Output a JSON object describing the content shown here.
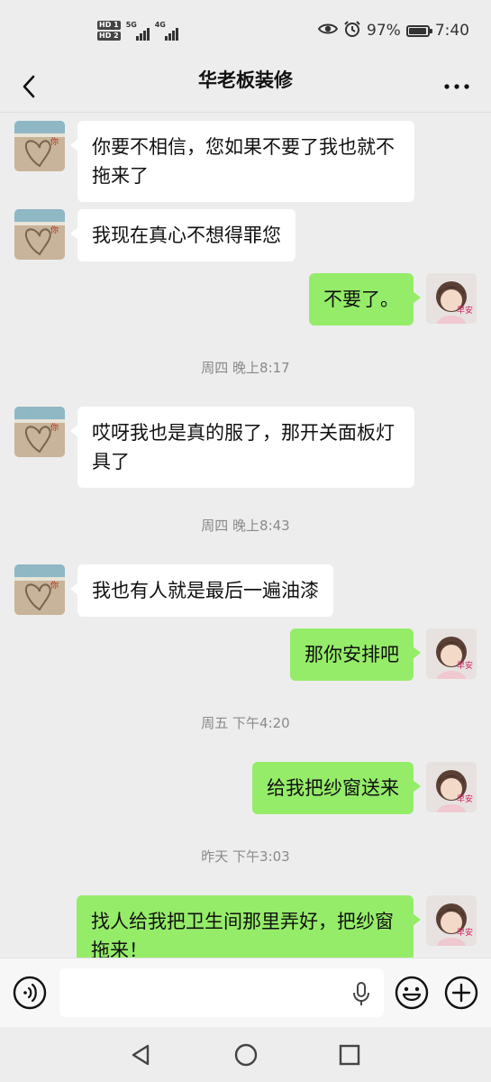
{
  "status_bar": {
    "hd1": "HD 1",
    "hd2": "HD 2",
    "sig1_label": "5G",
    "sig2_label": "4G",
    "battery_percent": "97%",
    "battery_level": 0.97,
    "time": "7:40",
    "icons": [
      "eye-icon",
      "alarm-icon"
    ]
  },
  "header": {
    "title": "华老板装修"
  },
  "contact_avatar": {
    "text": "你"
  },
  "self_avatar": {
    "text": "早安"
  },
  "messages": [
    {
      "side": "in",
      "text": "你要不相信，您如果不要了我也就不拖来了"
    },
    {
      "side": "in",
      "text": "我现在真心不想得罪您"
    },
    {
      "side": "out",
      "text": "不要了。"
    },
    {
      "timestamp": "周四 晚上8:17"
    },
    {
      "side": "in",
      "text": "哎呀我也是真的服了，那开关面板灯具了"
    },
    {
      "timestamp": "周四 晚上8:43"
    },
    {
      "side": "in",
      "text": "我也有人就是最后一遍油漆"
    },
    {
      "side": "out",
      "text": "那你安排吧"
    },
    {
      "timestamp": "周五 下午4:20"
    },
    {
      "side": "out",
      "text": "给我把纱窗送来"
    },
    {
      "timestamp": "昨天 下午3:03"
    },
    {
      "side": "out",
      "text": "找人给我把卫生间那里弄好，把纱窗拖来！"
    }
  ],
  "input_bar": {
    "value": "",
    "icons": [
      "voice-icon",
      "microphone-icon",
      "emoji-icon",
      "plus-icon"
    ]
  },
  "colors": {
    "background": "#EDEDED",
    "bubble_out": "#95EC69",
    "bubble_in": "#FFFFFF",
    "timestamp": "#8A8A8A"
  }
}
